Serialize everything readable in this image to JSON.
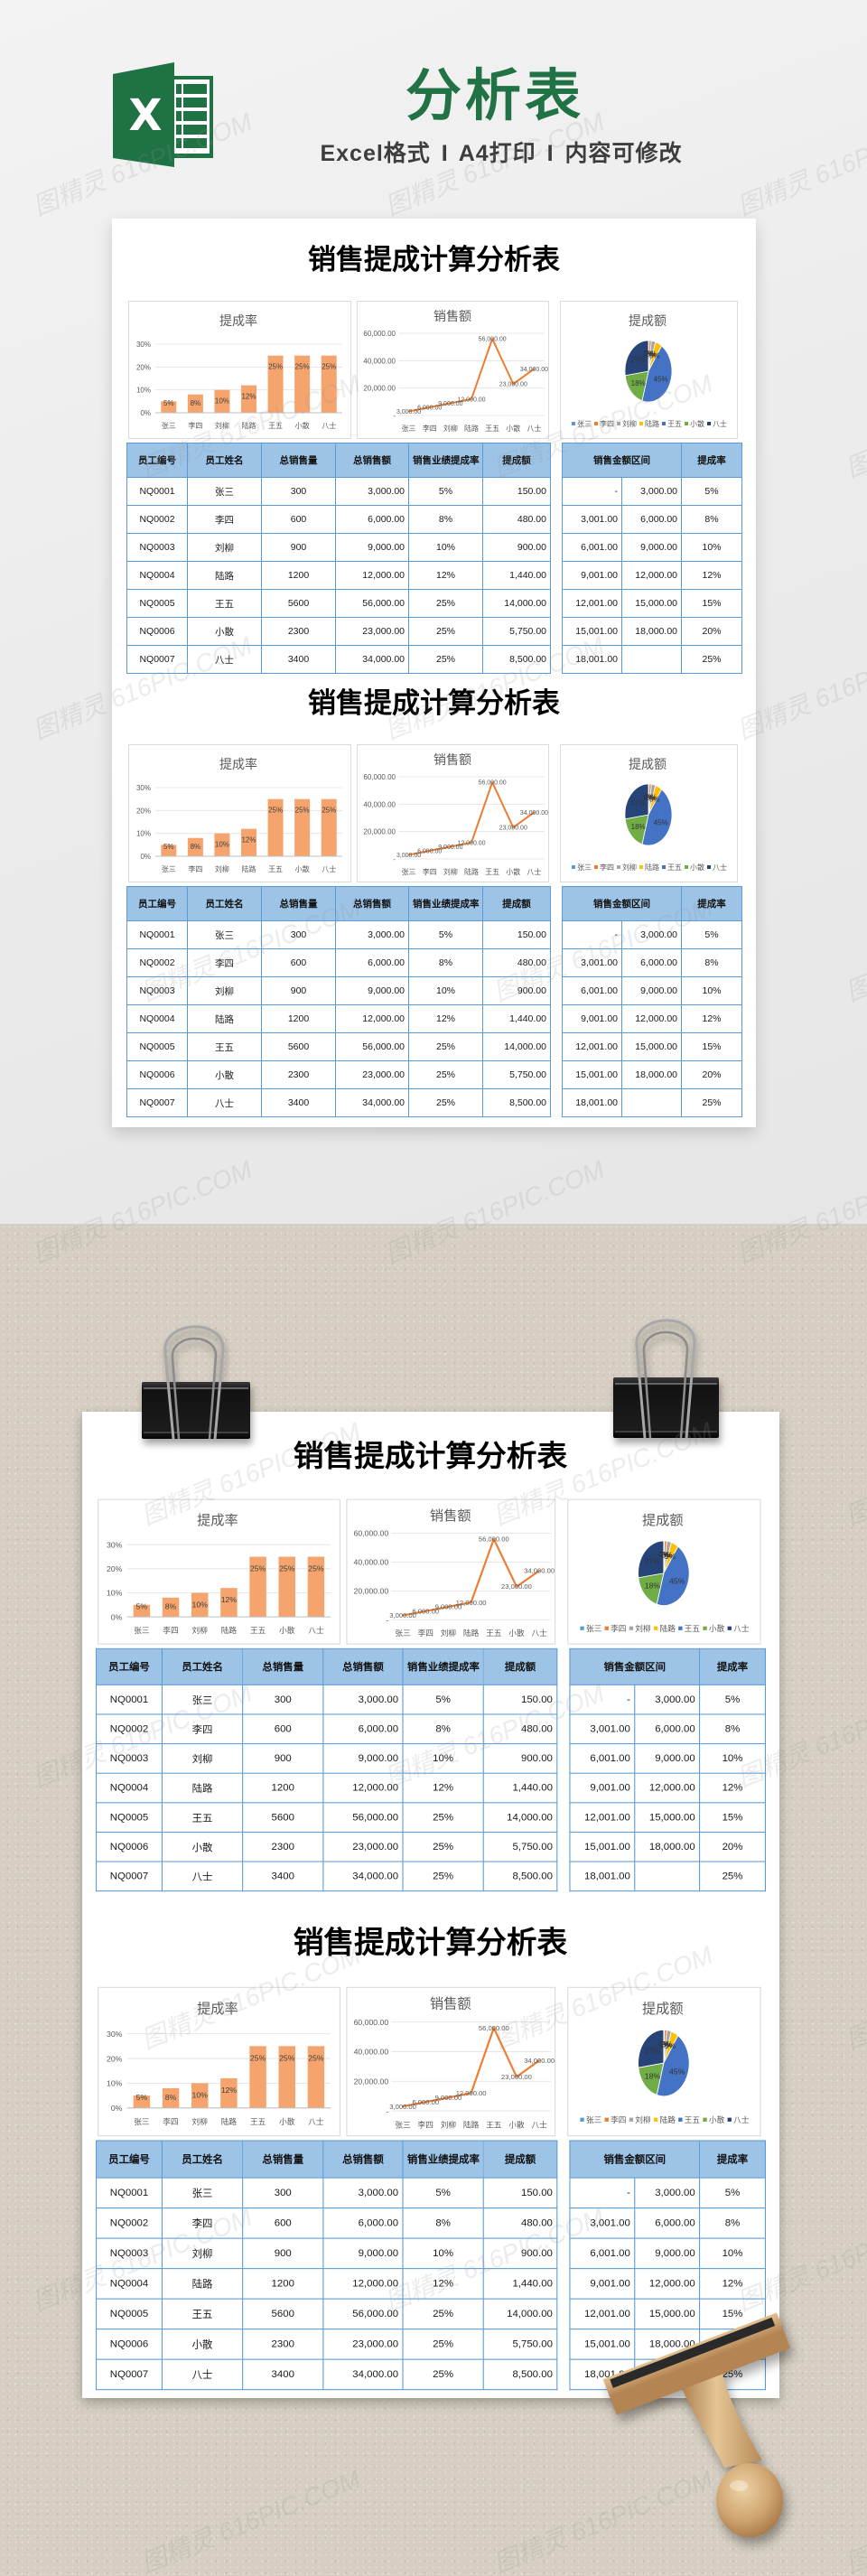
{
  "header": {
    "logo_letter": "X",
    "title": "分析表",
    "subtitle": "Excel格式 I A4打印 I 内容可修改"
  },
  "watermark": "图精灵 616PIC.COM",
  "theme": {
    "brand_green": "#217346",
    "header_fill": "#9dc3e6",
    "border": "#5b9bd5"
  },
  "sheet": {
    "title": "销售提成计算分析表",
    "main_table": {
      "headers": [
        "员工编号",
        "员工姓名",
        "总销售量",
        "总销售额",
        "销售业绩提成率",
        "提成额"
      ],
      "rows": [
        [
          "NQ0001",
          "张三",
          "300",
          "3,000.00",
          "5%",
          "150.00"
        ],
        [
          "NQ0002",
          "李四",
          "600",
          "6,000.00",
          "8%",
          "480.00"
        ],
        [
          "NQ0003",
          "刘柳",
          "900",
          "9,000.00",
          "10%",
          "900.00"
        ],
        [
          "NQ0004",
          "陆路",
          "1200",
          "12,000.00",
          "12%",
          "1,440.00"
        ],
        [
          "NQ0005",
          "王五",
          "5600",
          "56,000.00",
          "25%",
          "14,000.00"
        ],
        [
          "NQ0006",
          "小散",
          "2300",
          "23,000.00",
          "25%",
          "5,750.00"
        ],
        [
          "NQ0007",
          "八士",
          "3400",
          "34,000.00",
          "25%",
          "8,500.00"
        ]
      ]
    },
    "rate_table": {
      "headers": [
        "销售金额区间",
        "提成率"
      ],
      "rows": [
        [
          "-",
          "3,000.00",
          "5%"
        ],
        [
          "3,001.00",
          "6,000.00",
          "8%"
        ],
        [
          "6,001.00",
          "9,000.00",
          "10%"
        ],
        [
          "9,001.00",
          "12,000.00",
          "12%"
        ],
        [
          "12,001.00",
          "15,000.00",
          "15%"
        ],
        [
          "15,001.00",
          "18,000.00",
          "20%"
        ],
        [
          "18,001.00",
          "",
          "25%"
        ]
      ]
    }
  },
  "chart_data": [
    {
      "type": "bar",
      "title": "提成率",
      "categories": [
        "张三",
        "李四",
        "刘柳",
        "陆路",
        "王五",
        "小散",
        "八士"
      ],
      "values": [
        0.05,
        0.08,
        0.1,
        0.12,
        0.25,
        0.25,
        0.25
      ],
      "data_labels": [
        "5%",
        "8%",
        "10%",
        "12%",
        "25%",
        "25%",
        "25%"
      ],
      "yticks": [
        "0%",
        "10%",
        "20%",
        "30%"
      ],
      "ytick_values": [
        0,
        0.1,
        0.2,
        0.3
      ],
      "ylim": [
        0,
        0.3
      ],
      "xlabel": "",
      "ylabel": "",
      "grid": true,
      "legend": "none",
      "color": "#f4a46c"
    },
    {
      "type": "line",
      "title": "销售额",
      "categories": [
        "张三",
        "李四",
        "刘柳",
        "陆路",
        "王五",
        "小散",
        "八士"
      ],
      "values": [
        3000,
        6000,
        9000,
        12000,
        56000,
        23000,
        34000
      ],
      "data_labels": [
        "3,000.00",
        "6,000.00",
        "9,000.00",
        "12,000.00",
        "56,000.00",
        "23,000.00",
        "34,000.00"
      ],
      "yticks": [
        "-",
        "20,000.00",
        "40,000.00",
        "60,000.00"
      ],
      "ytick_values": [
        0,
        20000,
        40000,
        60000
      ],
      "ylim": [
        0,
        60000
      ],
      "xlabel": "",
      "ylabel": "",
      "grid": true,
      "legend": "none",
      "color": "#ed7d31"
    },
    {
      "type": "pie",
      "title": "提成额",
      "categories": [
        "张三",
        "李四",
        "刘柳",
        "陆路",
        "王五",
        "小散",
        "八士"
      ],
      "values": [
        150,
        480,
        900,
        1440,
        14000,
        5750,
        8500
      ],
      "data_labels": [
        "0%",
        "2%",
        "3%",
        "5%",
        "45%",
        "18%",
        "27%"
      ],
      "colors": [
        "#5b9bd5",
        "#ed7d31",
        "#a5a5a5",
        "#ffc000",
        "#4472c4",
        "#70ad47",
        "#264478"
      ],
      "legend": "bottom"
    }
  ]
}
